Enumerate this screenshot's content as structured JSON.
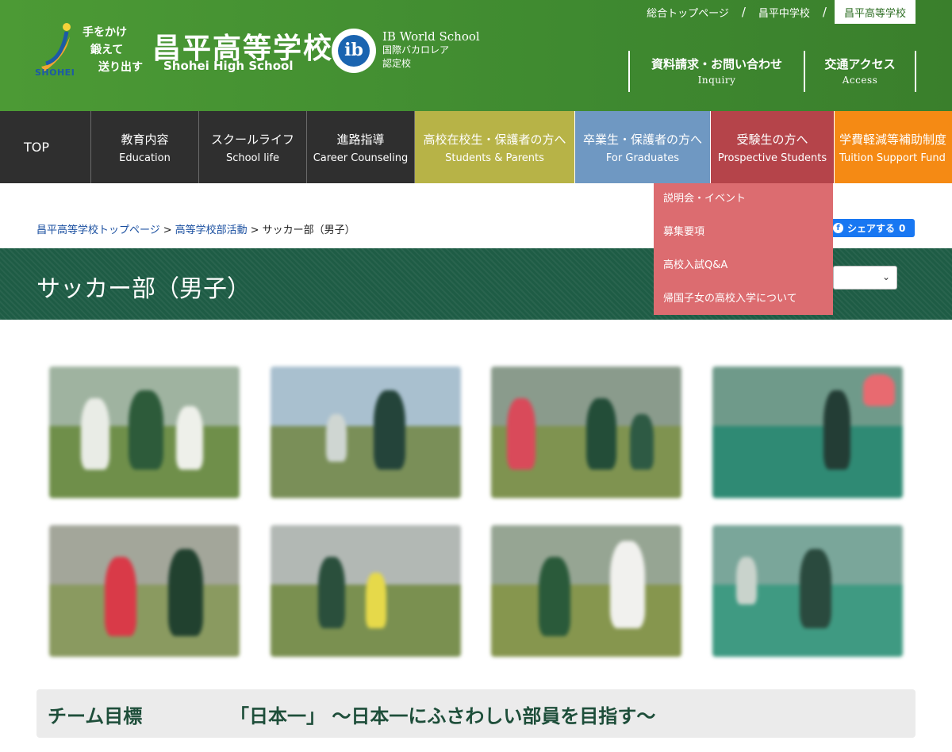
{
  "header": {
    "slogan": [
      "手をかけ",
      "鍛えて",
      "送り出す"
    ],
    "logo_word": "SHOHEI",
    "school_name_jp": "昌平高等学校",
    "school_name_en": "Shohei High School",
    "ib": {
      "logo_text": "ib",
      "line1": "IB World School",
      "line2": "国際バカロレア",
      "line3": "認定校"
    },
    "top_links": [
      {
        "label": "総合トップページ"
      },
      {
        "label": "昌平中学校"
      },
      {
        "label": "昌平高等学校",
        "active": true
      }
    ],
    "separator": "/",
    "buttons": [
      {
        "jp": "資料請求・お問い合わせ",
        "en": "Inquiry"
      },
      {
        "jp": "交通アクセス",
        "en": "Access"
      }
    ],
    "colors": {
      "header_green": "#4c9a35"
    }
  },
  "nav": {
    "top": "TOP",
    "items": [
      {
        "jp": "教育内容",
        "en": "Education",
        "color": "#2f2f2f"
      },
      {
        "jp": "スクールライフ",
        "en": "School life",
        "color": "#2f2f2f"
      },
      {
        "jp": "進路指導",
        "en": "Career Counseling",
        "color": "#2f2f2f"
      },
      {
        "jp": "高校在校生・保護者の方へ",
        "en": "Students & Parents",
        "color": "#b7b347"
      },
      {
        "jp": "卒業生・保護者の方へ",
        "en": "For Graduates",
        "color": "#6f98c2"
      },
      {
        "jp": "受験生の方へ",
        "en": "Prospective Students",
        "color": "#b5444a"
      },
      {
        "jp": "学費軽減等補助制度",
        "en": "Tuition Support Fund",
        "color": "#f58a14"
      }
    ]
  },
  "dropdown": {
    "items": [
      "説明会・イベント",
      "募集要項",
      "高校入試Q&A",
      "帰国子女の高校入学について"
    ],
    "color": "#dc6c70"
  },
  "breadcrumb": {
    "links": [
      "昌平高等学校トップページ",
      "高等学校部活動"
    ],
    "current": "サッカー部（男子）",
    "separator": ">"
  },
  "share": {
    "icon": "f",
    "label": "シェアする",
    "count": "0"
  },
  "page": {
    "title": "サッカー部（男子）",
    "select_chevron": "⌄"
  },
  "goal": {
    "label": "チーム目標",
    "text": "「日本一」 〜日本一にふさわしい部員を目指す〜"
  }
}
